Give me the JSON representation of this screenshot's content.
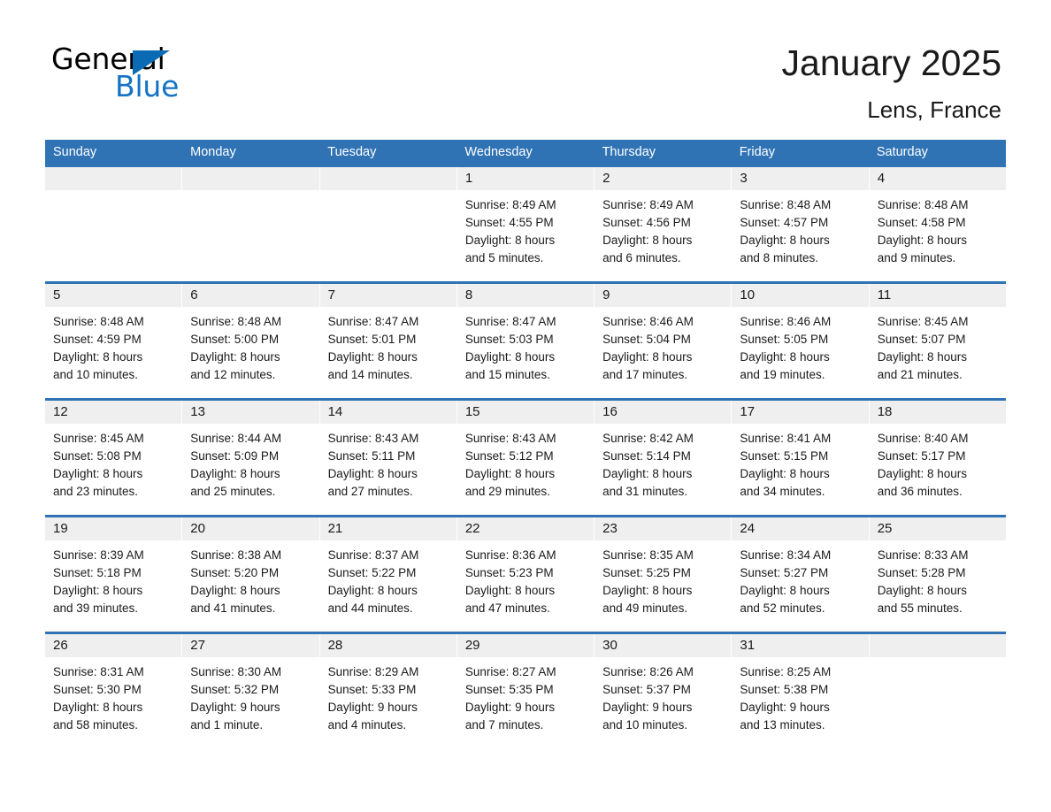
{
  "brand": {
    "name_part1": "General",
    "name_part2": "Blue",
    "accent_color": "#1473c4",
    "triangle_color": "#0a6ab4"
  },
  "header": {
    "title": "January 2025",
    "location": "Lens, France"
  },
  "calendar": {
    "header_bg": "#3073b4",
    "daynum_bg": "#efefef",
    "weekdays": [
      "Sunday",
      "Monday",
      "Tuesday",
      "Wednesday",
      "Thursday",
      "Friday",
      "Saturday"
    ],
    "weeks": [
      [
        {
          "day": "",
          "empty": true
        },
        {
          "day": "",
          "empty": true
        },
        {
          "day": "",
          "empty": true
        },
        {
          "day": "1",
          "sunrise": "Sunrise: 8:49 AM",
          "sunset": "Sunset: 4:55 PM",
          "daylight1": "Daylight: 8 hours",
          "daylight2": "and 5 minutes."
        },
        {
          "day": "2",
          "sunrise": "Sunrise: 8:49 AM",
          "sunset": "Sunset: 4:56 PM",
          "daylight1": "Daylight: 8 hours",
          "daylight2": "and 6 minutes."
        },
        {
          "day": "3",
          "sunrise": "Sunrise: 8:48 AM",
          "sunset": "Sunset: 4:57 PM",
          "daylight1": "Daylight: 8 hours",
          "daylight2": "and 8 minutes."
        },
        {
          "day": "4",
          "sunrise": "Sunrise: 8:48 AM",
          "sunset": "Sunset: 4:58 PM",
          "daylight1": "Daylight: 8 hours",
          "daylight2": "and 9 minutes."
        }
      ],
      [
        {
          "day": "5",
          "sunrise": "Sunrise: 8:48 AM",
          "sunset": "Sunset: 4:59 PM",
          "daylight1": "Daylight: 8 hours",
          "daylight2": "and 10 minutes."
        },
        {
          "day": "6",
          "sunrise": "Sunrise: 8:48 AM",
          "sunset": "Sunset: 5:00 PM",
          "daylight1": "Daylight: 8 hours",
          "daylight2": "and 12 minutes."
        },
        {
          "day": "7",
          "sunrise": "Sunrise: 8:47 AM",
          "sunset": "Sunset: 5:01 PM",
          "daylight1": "Daylight: 8 hours",
          "daylight2": "and 14 minutes."
        },
        {
          "day": "8",
          "sunrise": "Sunrise: 8:47 AM",
          "sunset": "Sunset: 5:03 PM",
          "daylight1": "Daylight: 8 hours",
          "daylight2": "and 15 minutes."
        },
        {
          "day": "9",
          "sunrise": "Sunrise: 8:46 AM",
          "sunset": "Sunset: 5:04 PM",
          "daylight1": "Daylight: 8 hours",
          "daylight2": "and 17 minutes."
        },
        {
          "day": "10",
          "sunrise": "Sunrise: 8:46 AM",
          "sunset": "Sunset: 5:05 PM",
          "daylight1": "Daylight: 8 hours",
          "daylight2": "and 19 minutes."
        },
        {
          "day": "11",
          "sunrise": "Sunrise: 8:45 AM",
          "sunset": "Sunset: 5:07 PM",
          "daylight1": "Daylight: 8 hours",
          "daylight2": "and 21 minutes."
        }
      ],
      [
        {
          "day": "12",
          "sunrise": "Sunrise: 8:45 AM",
          "sunset": "Sunset: 5:08 PM",
          "daylight1": "Daylight: 8 hours",
          "daylight2": "and 23 minutes."
        },
        {
          "day": "13",
          "sunrise": "Sunrise: 8:44 AM",
          "sunset": "Sunset: 5:09 PM",
          "daylight1": "Daylight: 8 hours",
          "daylight2": "and 25 minutes."
        },
        {
          "day": "14",
          "sunrise": "Sunrise: 8:43 AM",
          "sunset": "Sunset: 5:11 PM",
          "daylight1": "Daylight: 8 hours",
          "daylight2": "and 27 minutes."
        },
        {
          "day": "15",
          "sunrise": "Sunrise: 8:43 AM",
          "sunset": "Sunset: 5:12 PM",
          "daylight1": "Daylight: 8 hours",
          "daylight2": "and 29 minutes."
        },
        {
          "day": "16",
          "sunrise": "Sunrise: 8:42 AM",
          "sunset": "Sunset: 5:14 PM",
          "daylight1": "Daylight: 8 hours",
          "daylight2": "and 31 minutes."
        },
        {
          "day": "17",
          "sunrise": "Sunrise: 8:41 AM",
          "sunset": "Sunset: 5:15 PM",
          "daylight1": "Daylight: 8 hours",
          "daylight2": "and 34 minutes."
        },
        {
          "day": "18",
          "sunrise": "Sunrise: 8:40 AM",
          "sunset": "Sunset: 5:17 PM",
          "daylight1": "Daylight: 8 hours",
          "daylight2": "and 36 minutes."
        }
      ],
      [
        {
          "day": "19",
          "sunrise": "Sunrise: 8:39 AM",
          "sunset": "Sunset: 5:18 PM",
          "daylight1": "Daylight: 8 hours",
          "daylight2": "and 39 minutes."
        },
        {
          "day": "20",
          "sunrise": "Sunrise: 8:38 AM",
          "sunset": "Sunset: 5:20 PM",
          "daylight1": "Daylight: 8 hours",
          "daylight2": "and 41 minutes."
        },
        {
          "day": "21",
          "sunrise": "Sunrise: 8:37 AM",
          "sunset": "Sunset: 5:22 PM",
          "daylight1": "Daylight: 8 hours",
          "daylight2": "and 44 minutes."
        },
        {
          "day": "22",
          "sunrise": "Sunrise: 8:36 AM",
          "sunset": "Sunset: 5:23 PM",
          "daylight1": "Daylight: 8 hours",
          "daylight2": "and 47 minutes."
        },
        {
          "day": "23",
          "sunrise": "Sunrise: 8:35 AM",
          "sunset": "Sunset: 5:25 PM",
          "daylight1": "Daylight: 8 hours",
          "daylight2": "and 49 minutes."
        },
        {
          "day": "24",
          "sunrise": "Sunrise: 8:34 AM",
          "sunset": "Sunset: 5:27 PM",
          "daylight1": "Daylight: 8 hours",
          "daylight2": "and 52 minutes."
        },
        {
          "day": "25",
          "sunrise": "Sunrise: 8:33 AM",
          "sunset": "Sunset: 5:28 PM",
          "daylight1": "Daylight: 8 hours",
          "daylight2": "and 55 minutes."
        }
      ],
      [
        {
          "day": "26",
          "sunrise": "Sunrise: 8:31 AM",
          "sunset": "Sunset: 5:30 PM",
          "daylight1": "Daylight: 8 hours",
          "daylight2": "and 58 minutes."
        },
        {
          "day": "27",
          "sunrise": "Sunrise: 8:30 AM",
          "sunset": "Sunset: 5:32 PM",
          "daylight1": "Daylight: 9 hours",
          "daylight2": "and 1 minute."
        },
        {
          "day": "28",
          "sunrise": "Sunrise: 8:29 AM",
          "sunset": "Sunset: 5:33 PM",
          "daylight1": "Daylight: 9 hours",
          "daylight2": "and 4 minutes."
        },
        {
          "day": "29",
          "sunrise": "Sunrise: 8:27 AM",
          "sunset": "Sunset: 5:35 PM",
          "daylight1": "Daylight: 9 hours",
          "daylight2": "and 7 minutes."
        },
        {
          "day": "30",
          "sunrise": "Sunrise: 8:26 AM",
          "sunset": "Sunset: 5:37 PM",
          "daylight1": "Daylight: 9 hours",
          "daylight2": "and 10 minutes."
        },
        {
          "day": "31",
          "sunrise": "Sunrise: 8:25 AM",
          "sunset": "Sunset: 5:38 PM",
          "daylight1": "Daylight: 9 hours",
          "daylight2": "and 13 minutes."
        },
        {
          "day": "",
          "empty": true
        }
      ]
    ]
  }
}
